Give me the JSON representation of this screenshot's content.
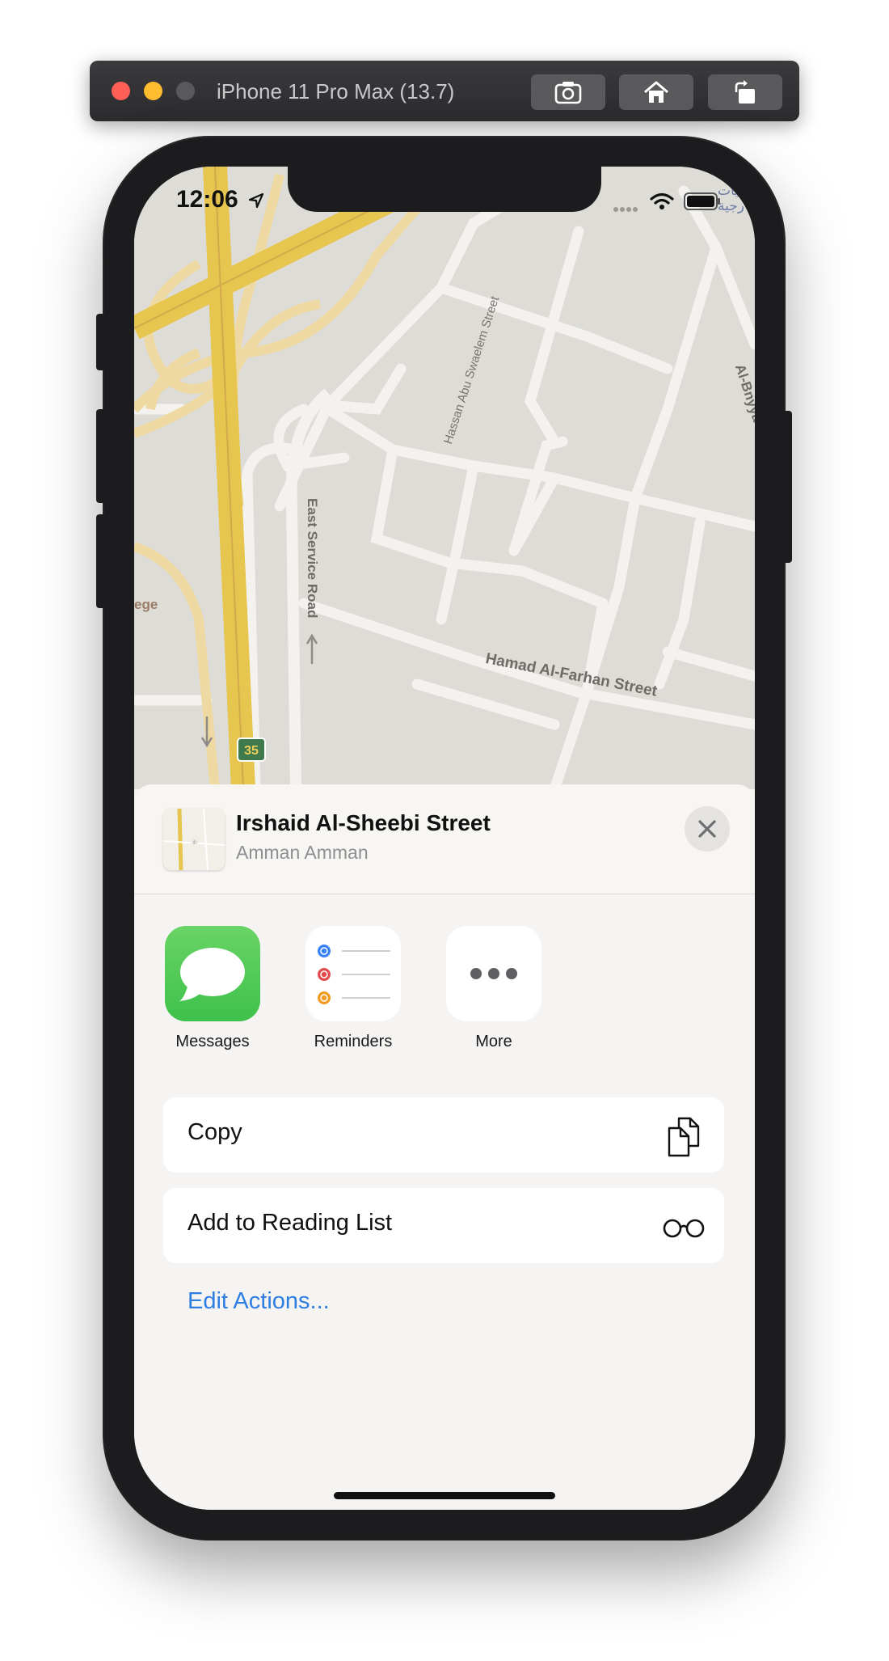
{
  "window": {
    "title": "iPhone 11 Pro Max (13.7)",
    "buttons": [
      "screenshot-icon",
      "home-icon",
      "rotate-icon"
    ]
  },
  "status_bar": {
    "time": "12:06",
    "icons": [
      "location-arrow-icon",
      "signal-icon",
      "wifi-icon",
      "battery-icon"
    ]
  },
  "map": {
    "labels": {
      "street1": "Hassan Abu Swaelem Street",
      "street2": "East Service Road",
      "street3": "Hamad Al-Farhan Street",
      "street4": "Al-Bnyya",
      "poi": "ege",
      "arabic": "يات رجية",
      "route_shield": "35"
    },
    "colors": {
      "land": "#dedcd6",
      "road": "#f2f1ee",
      "highway": "#e6c64e"
    }
  },
  "share_sheet": {
    "title": "Irshaid Al-Sheebi Street",
    "subtitle": "Amman Amman",
    "apps": [
      {
        "label": "Messages",
        "icon": "messages-icon"
      },
      {
        "label": "Reminders",
        "icon": "reminders-icon"
      },
      {
        "label": "More",
        "icon": "more-icon"
      }
    ],
    "actions": [
      {
        "label": "Copy",
        "icon": "copy-icon"
      },
      {
        "label": "Add to Reading List",
        "icon": "glasses-icon"
      }
    ],
    "edit_actions": "Edit Actions...",
    "link_color": "#2e7de1"
  }
}
